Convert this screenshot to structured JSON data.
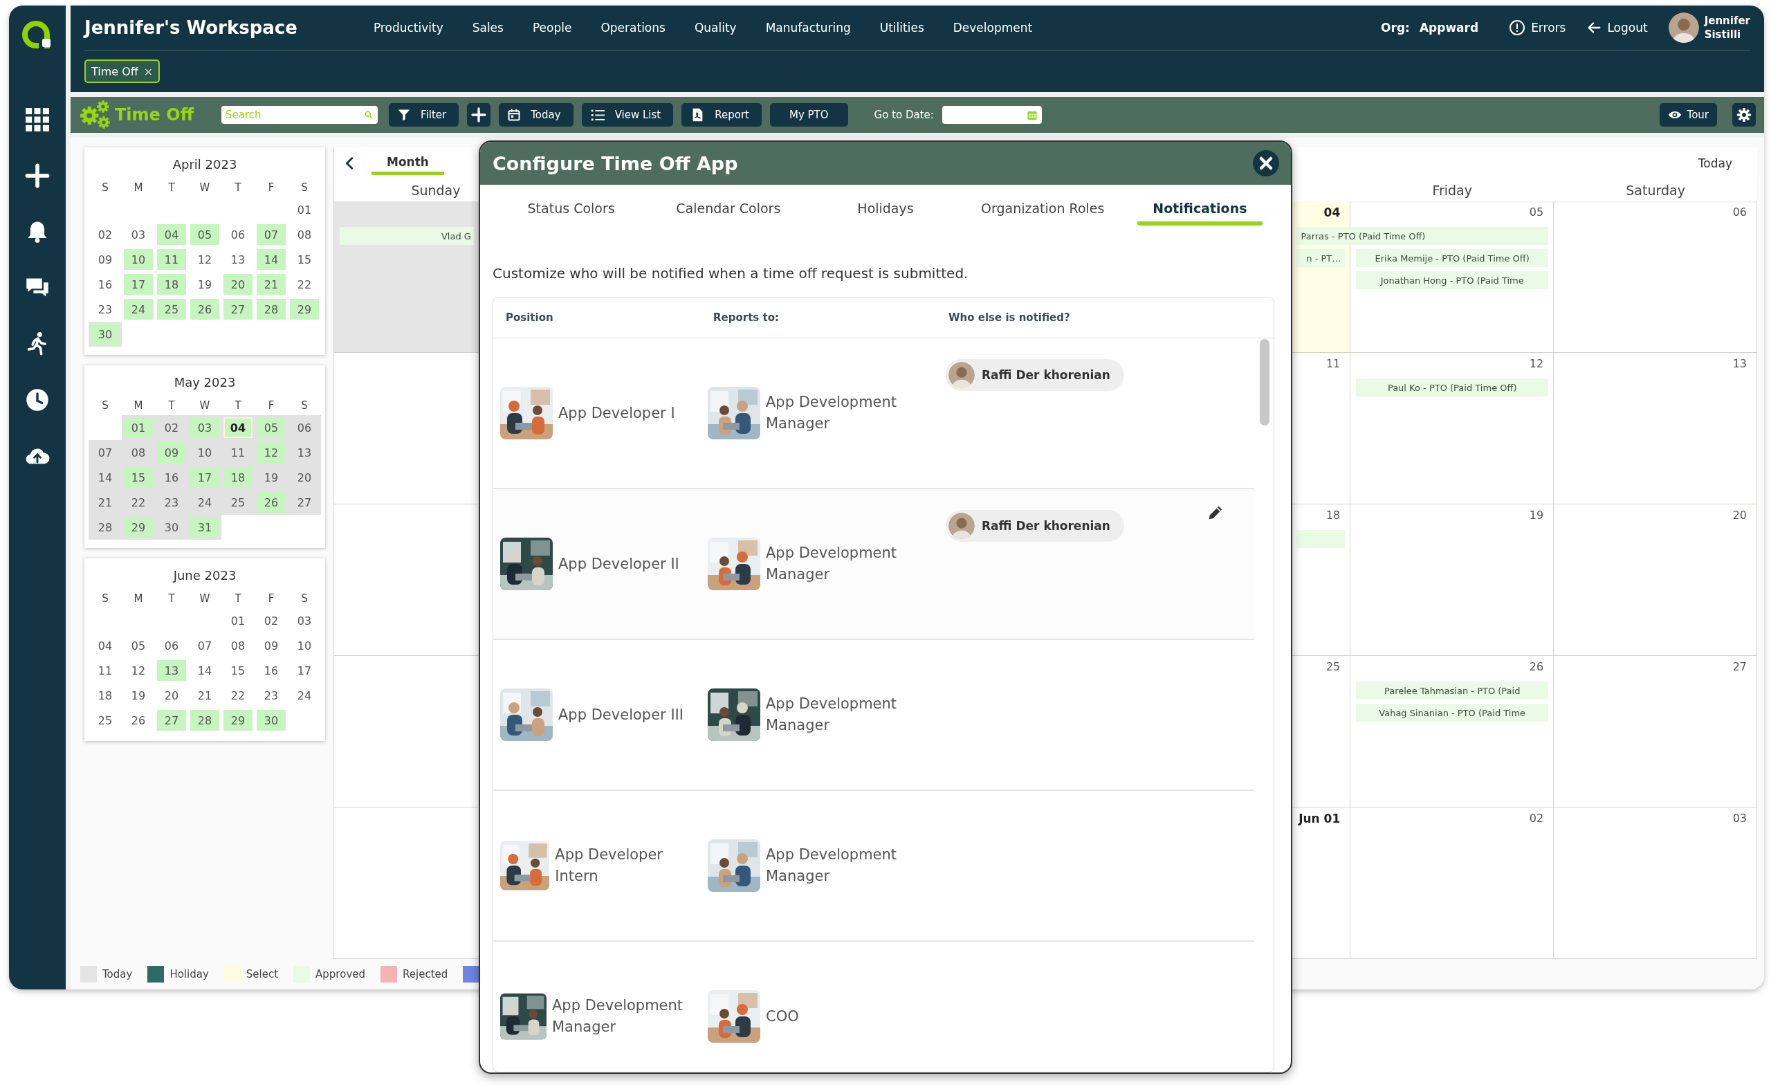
{
  "header": {
    "title": "Jennifer's Workspace",
    "nav": [
      "Productivity",
      "Sales",
      "People",
      "Operations",
      "Quality",
      "Manufacturing",
      "Utilities",
      "Development"
    ],
    "org_label": "Org:",
    "org": "Appward",
    "errors": "Errors",
    "logout": "Logout",
    "user": [
      "Jennifer",
      "Sistilli"
    ],
    "open_tabs": [
      {
        "label": "Time Off",
        "close": "×"
      }
    ]
  },
  "toolbar": {
    "app_title": "Time Off",
    "search": {
      "placeholder": "Search"
    },
    "buttons": [
      {
        "kind": "filter",
        "label": "Filter"
      },
      {
        "kind": "add"
      },
      {
        "kind": "today",
        "label": "Today"
      },
      {
        "kind": "list",
        "label": "View List"
      },
      {
        "kind": "report",
        "label": "Report"
      },
      {
        "kind": "plain",
        "label": "My PTO"
      }
    ],
    "go_to_date_label": "Go to Date:",
    "tour": "Tour"
  },
  "mini_calendars": [
    {
      "title": "April 2023",
      "weekdays": [
        "S",
        "M",
        "T",
        "W",
        "T",
        "F",
        "S"
      ],
      "weeks": [
        [
          {
            "kind": "blank"
          },
          {
            "kind": "blank"
          },
          {
            "kind": "blank"
          },
          {
            "kind": "blank"
          },
          {
            "kind": "blank"
          },
          {
            "kind": "blank"
          },
          {
            "kind": "day",
            "day": "01",
            "marked": false,
            "in_view": false,
            "today": false
          }
        ],
        [
          {
            "kind": "day",
            "day": "02",
            "marked": false,
            "in_view": false,
            "today": false
          },
          {
            "kind": "day",
            "day": "03",
            "marked": false,
            "in_view": false,
            "today": false
          },
          {
            "kind": "day",
            "day": "04",
            "marked": true,
            "in_view": false,
            "today": false
          },
          {
            "kind": "day",
            "day": "05",
            "marked": true,
            "in_view": false,
            "today": false
          },
          {
            "kind": "day",
            "day": "06",
            "marked": false,
            "in_view": false,
            "today": false
          },
          {
            "kind": "day",
            "day": "07",
            "marked": true,
            "in_view": false,
            "today": false
          },
          {
            "kind": "day",
            "day": "08",
            "marked": false,
            "in_view": false,
            "today": false
          }
        ],
        [
          {
            "kind": "day",
            "day": "09",
            "marked": false,
            "in_view": false,
            "today": false
          },
          {
            "kind": "day",
            "day": "10",
            "marked": true,
            "in_view": false,
            "today": false
          },
          {
            "kind": "day",
            "day": "11",
            "marked": true,
            "in_view": false,
            "today": false
          },
          {
            "kind": "day",
            "day": "12",
            "marked": false,
            "in_view": false,
            "today": false
          },
          {
            "kind": "day",
            "day": "13",
            "marked": false,
            "in_view": false,
            "today": false
          },
          {
            "kind": "day",
            "day": "14",
            "marked": true,
            "in_view": false,
            "today": false
          },
          {
            "kind": "day",
            "day": "15",
            "marked": false,
            "in_view": false,
            "today": false
          }
        ],
        [
          {
            "kind": "day",
            "day": "16",
            "marked": false,
            "in_view": false,
            "today": false
          },
          {
            "kind": "day",
            "day": "17",
            "marked": true,
            "in_view": false,
            "today": false
          },
          {
            "kind": "day",
            "day": "18",
            "marked": true,
            "in_view": false,
            "today": false
          },
          {
            "kind": "day",
            "day": "19",
            "marked": false,
            "in_view": false,
            "today": false
          },
          {
            "kind": "day",
            "day": "20",
            "marked": true,
            "in_view": false,
            "today": false
          },
          {
            "kind": "day",
            "day": "21",
            "marked": true,
            "in_view": false,
            "today": false
          },
          {
            "kind": "day",
            "day": "22",
            "marked": false,
            "in_view": false,
            "today": false
          }
        ],
        [
          {
            "kind": "day",
            "day": "23",
            "marked": false,
            "in_view": false,
            "today": false
          },
          {
            "kind": "day",
            "day": "24",
            "marked": true,
            "in_view": false,
            "today": false
          },
          {
            "kind": "day",
            "day": "25",
            "marked": true,
            "in_view": false,
            "today": false
          },
          {
            "kind": "day",
            "day": "26",
            "marked": true,
            "in_view": false,
            "today": false
          },
          {
            "kind": "day",
            "day": "27",
            "marked": true,
            "in_view": false,
            "today": false
          },
          {
            "kind": "day",
            "day": "28",
            "marked": true,
            "in_view": false,
            "today": false
          },
          {
            "kind": "day",
            "day": "29",
            "marked": true,
            "in_view": false,
            "today": false
          }
        ],
        [
          {
            "kind": "day",
            "day": "30",
            "marked": true,
            "in_view": true,
            "today": false
          }
        ]
      ]
    },
    {
      "title": "May 2023",
      "weekdays": [
        "S",
        "M",
        "T",
        "W",
        "T",
        "F",
        "S"
      ],
      "weeks": [
        [
          {
            "kind": "blank"
          },
          {
            "kind": "day",
            "day": "01",
            "marked": true,
            "in_view": true,
            "today": false
          },
          {
            "kind": "day",
            "day": "02",
            "marked": false,
            "in_view": true,
            "today": false
          },
          {
            "kind": "day",
            "day": "03",
            "marked": true,
            "in_view": true,
            "today": false
          },
          {
            "kind": "day",
            "day": "04",
            "marked": true,
            "in_view": true,
            "today": true
          },
          {
            "kind": "day",
            "day": "05",
            "marked": true,
            "in_view": true,
            "today": false
          },
          {
            "kind": "day",
            "day": "06",
            "marked": false,
            "in_view": true,
            "today": false
          }
        ],
        [
          {
            "kind": "day",
            "day": "07",
            "marked": false,
            "in_view": true,
            "today": false
          },
          {
            "kind": "day",
            "day": "08",
            "marked": false,
            "in_view": true,
            "today": false
          },
          {
            "kind": "day",
            "day": "09",
            "marked": true,
            "in_view": true,
            "today": false
          },
          {
            "kind": "day",
            "day": "10",
            "marked": false,
            "in_view": true,
            "today": false
          },
          {
            "kind": "day",
            "day": "11",
            "marked": false,
            "in_view": true,
            "today": false
          },
          {
            "kind": "day",
            "day": "12",
            "marked": true,
            "in_view": true,
            "today": false
          },
          {
            "kind": "day",
            "day": "13",
            "marked": false,
            "in_view": true,
            "today": false
          }
        ],
        [
          {
            "kind": "day",
            "day": "14",
            "marked": false,
            "in_view": true,
            "today": false
          },
          {
            "kind": "day",
            "day": "15",
            "marked": true,
            "in_view": true,
            "today": false
          },
          {
            "kind": "day",
            "day": "16",
            "marked": false,
            "in_view": true,
            "today": false
          },
          {
            "kind": "day",
            "day": "17",
            "marked": true,
            "in_view": true,
            "today": false
          },
          {
            "kind": "day",
            "day": "18",
            "marked": true,
            "in_view": true,
            "today": false
          },
          {
            "kind": "day",
            "day": "19",
            "marked": false,
            "in_view": true,
            "today": false
          },
          {
            "kind": "day",
            "day": "20",
            "marked": false,
            "in_view": true,
            "today": false
          }
        ],
        [
          {
            "kind": "day",
            "day": "21",
            "marked": false,
            "in_view": true,
            "today": false
          },
          {
            "kind": "day",
            "day": "22",
            "marked": false,
            "in_view": true,
            "today": false
          },
          {
            "kind": "day",
            "day": "23",
            "marked": false,
            "in_view": true,
            "today": false
          },
          {
            "kind": "day",
            "day": "24",
            "marked": false,
            "in_view": true,
            "today": false
          },
          {
            "kind": "day",
            "day": "25",
            "marked": false,
            "in_view": true,
            "today": false
          },
          {
            "kind": "day",
            "day": "26",
            "marked": true,
            "in_view": true,
            "today": false
          },
          {
            "kind": "day",
            "day": "27",
            "marked": false,
            "in_view": true,
            "today": false
          }
        ],
        [
          {
            "kind": "day",
            "day": "28",
            "marked": false,
            "in_view": true,
            "today": false
          },
          {
            "kind": "day",
            "day": "29",
            "marked": true,
            "in_view": true,
            "today": false
          },
          {
            "kind": "day",
            "day": "30",
            "marked": false,
            "in_view": true,
            "today": false
          },
          {
            "kind": "day",
            "day": "31",
            "marked": true,
            "in_view": true,
            "today": false
          }
        ]
      ]
    },
    {
      "title": "June 2023",
      "weekdays": [
        "S",
        "M",
        "T",
        "W",
        "T",
        "F",
        "S"
      ],
      "weeks": [
        [
          {
            "kind": "blank"
          },
          {
            "kind": "blank"
          },
          {
            "kind": "blank"
          },
          {
            "kind": "blank"
          },
          {
            "kind": "day",
            "day": "01",
            "marked": false,
            "in_view": false,
            "today": false
          },
          {
            "kind": "day",
            "day": "02",
            "marked": false,
            "in_view": false,
            "today": false
          },
          {
            "kind": "day",
            "day": "03",
            "marked": false,
            "in_view": false,
            "today": false
          }
        ],
        [
          {
            "kind": "day",
            "day": "04",
            "marked": false,
            "in_view": false,
            "today": false
          },
          {
            "kind": "day",
            "day": "05",
            "marked": false,
            "in_view": false,
            "today": false
          },
          {
            "kind": "day",
            "day": "06",
            "marked": false,
            "in_view": false,
            "today": false
          },
          {
            "kind": "day",
            "day": "07",
            "marked": false,
            "in_view": false,
            "today": false
          },
          {
            "kind": "day",
            "day": "08",
            "marked": false,
            "in_view": false,
            "today": false
          },
          {
            "kind": "day",
            "day": "09",
            "marked": false,
            "in_view": false,
            "today": false
          },
          {
            "kind": "day",
            "day": "10",
            "marked": false,
            "in_view": false,
            "today": false
          }
        ],
        [
          {
            "kind": "day",
            "day": "11",
            "marked": false,
            "in_view": false,
            "today": false
          },
          {
            "kind": "day",
            "day": "12",
            "marked": false,
            "in_view": false,
            "today": false
          },
          {
            "kind": "day",
            "day": "13",
            "marked": true,
            "in_view": false,
            "today": false
          },
          {
            "kind": "day",
            "day": "14",
            "marked": false,
            "in_view": false,
            "today": false
          },
          {
            "kind": "day",
            "day": "15",
            "marked": false,
            "in_view": false,
            "today": false
          },
          {
            "kind": "day",
            "day": "16",
            "marked": false,
            "in_view": false,
            "today": false
          },
          {
            "kind": "day",
            "day": "17",
            "marked": false,
            "in_view": false,
            "today": false
          }
        ],
        [
          {
            "kind": "day",
            "day": "18",
            "marked": false,
            "in_view": false,
            "today": false
          },
          {
            "kind": "day",
            "day": "19",
            "marked": false,
            "in_view": false,
            "today": false
          },
          {
            "kind": "day",
            "day": "20",
            "marked": false,
            "in_view": false,
            "today": false
          },
          {
            "kind": "day",
            "day": "21",
            "marked": false,
            "in_view": false,
            "today": false
          },
          {
            "kind": "day",
            "day": "22",
            "marked": false,
            "in_view": false,
            "today": false
          },
          {
            "kind": "day",
            "day": "23",
            "marked": false,
            "in_view": false,
            "today": false
          },
          {
            "kind": "day",
            "day": "24",
            "marked": false,
            "in_view": false,
            "today": false
          }
        ],
        [
          {
            "kind": "day",
            "day": "25",
            "marked": false,
            "in_view": false,
            "today": false
          },
          {
            "kind": "day",
            "day": "26",
            "marked": false,
            "in_view": false,
            "today": false
          },
          {
            "kind": "day",
            "day": "27",
            "marked": true,
            "in_view": false,
            "today": false
          },
          {
            "kind": "day",
            "day": "28",
            "marked": true,
            "in_view": false,
            "today": false
          },
          {
            "kind": "day",
            "day": "29",
            "marked": true,
            "in_view": false,
            "today": false
          },
          {
            "kind": "day",
            "day": "30",
            "marked": true,
            "in_view": false,
            "today": false
          }
        ]
      ]
    }
  ],
  "calendar": {
    "views": [
      {
        "label": "Month",
        "selected": true
      }
    ],
    "today_link": "Today",
    "weekdays": [
      {
        "kind": "header",
        "label": "Sunday"
      },
      {
        "kind": "covered"
      },
      {
        "kind": "covered"
      },
      {
        "kind": "covered"
      },
      {
        "kind": "covered"
      },
      {
        "kind": "header",
        "label": "Friday"
      },
      {
        "kind": "header",
        "label": "Saturday"
      }
    ],
    "weeks": [
      {
        "cells": [
          {
            "kind": "day",
            "shaded": true,
            "today": false,
            "events": [
              {
                "kind": "single",
                "text": "Vlad G"
              }
            ]
          },
          {
            "kind": "covered"
          },
          {
            "kind": "covered"
          },
          {
            "kind": "covered"
          },
          {
            "kind": "day",
            "date": "04",
            "shaded": false,
            "today": true,
            "bold": true,
            "events": [
              {
                "kind": "span",
                "text": "Parras - PTO (Paid Time Off)"
              },
              {
                "kind": "single",
                "text": "n - PT…"
              }
            ]
          },
          {
            "kind": "day",
            "date": "05",
            "shaded": false,
            "today": false,
            "bold": false,
            "events": [
              {
                "kind": "single",
                "text": "Erika Memije - PTO (Paid Time Off)"
              },
              {
                "kind": "single",
                "text": "Jonathan Hong - PTO (Paid Time"
              }
            ]
          },
          {
            "kind": "day",
            "date": "06",
            "shaded": false,
            "today": false,
            "bold": false
          }
        ]
      },
      {
        "cells": [
          {
            "kind": "day",
            "shaded": false,
            "today": false
          },
          {
            "kind": "covered"
          },
          {
            "kind": "covered"
          },
          {
            "kind": "covered"
          },
          {
            "kind": "day",
            "date": "11",
            "shaded": false,
            "today": false,
            "bold": false
          },
          {
            "kind": "day",
            "date": "12",
            "shaded": false,
            "today": false,
            "bold": false,
            "events": [
              {
                "kind": "single",
                "text": "Paul Ko - PTO (Paid Time Off)"
              }
            ]
          },
          {
            "kind": "day",
            "date": "13",
            "shaded": false,
            "today": false,
            "bold": false
          }
        ]
      },
      {
        "cells": [
          {
            "kind": "day",
            "shaded": false,
            "today": false
          },
          {
            "kind": "covered"
          },
          {
            "kind": "covered"
          },
          {
            "kind": "covered"
          },
          {
            "kind": "day",
            "date": "18",
            "shaded": false,
            "today": false,
            "bold": false,
            "events": [
              {
                "kind": "single"
              }
            ]
          },
          {
            "kind": "day",
            "date": "19",
            "shaded": false,
            "today": false,
            "bold": false
          },
          {
            "kind": "day",
            "date": "20",
            "shaded": false,
            "today": false,
            "bold": false
          }
        ]
      },
      {
        "cells": [
          {
            "kind": "day",
            "shaded": false,
            "today": false
          },
          {
            "kind": "covered"
          },
          {
            "kind": "covered"
          },
          {
            "kind": "covered"
          },
          {
            "kind": "day",
            "date": "25",
            "shaded": false,
            "today": false,
            "bold": false
          },
          {
            "kind": "day",
            "date": "26",
            "shaded": false,
            "today": false,
            "bold": false,
            "events": [
              {
                "kind": "single",
                "text": "Parelee Tahmasian - PTO (Paid"
              },
              {
                "kind": "single",
                "text": "Vahag Sinanian - PTO (Paid Time"
              }
            ]
          },
          {
            "kind": "day",
            "date": "27",
            "shaded": false,
            "today": false,
            "bold": false
          }
        ]
      },
      {
        "cells": [
          {
            "kind": "day",
            "shaded": false,
            "today": false
          },
          {
            "kind": "covered"
          },
          {
            "kind": "covered"
          },
          {
            "kind": "covered"
          },
          {
            "kind": "day",
            "date": "Jun 01",
            "shaded": false,
            "today": false,
            "bold": true
          },
          {
            "kind": "day",
            "date": "02",
            "shaded": false,
            "today": false,
            "bold": false
          },
          {
            "kind": "day",
            "date": "03",
            "shaded": false,
            "today": false,
            "bold": false
          }
        ]
      }
    ]
  },
  "legend": [
    {
      "label": "Today",
      "color": "#e4e4e4"
    },
    {
      "label": "Holiday",
      "color": "#2f6b62"
    },
    {
      "label": "Select",
      "color": "#fffbe0"
    },
    {
      "label": "Approved",
      "color": "#e8fbe3"
    },
    {
      "label": "Rejected",
      "color": "#f7b3b3"
    },
    {
      "color": "#6d86e6"
    }
  ],
  "modal": {
    "title": "Configure Time Off App",
    "tabs": [
      {
        "label": "Status Colors",
        "selected": false
      },
      {
        "label": "Calendar Colors",
        "selected": false
      },
      {
        "label": "Holidays",
        "selected": false
      },
      {
        "label": "Organization Roles",
        "selected": false
      },
      {
        "label": "Notifications",
        "selected": true
      }
    ],
    "description": "Customize who will be notified when a time off request is submitted.",
    "columns": [
      "Position",
      "Reports to:",
      "Who else is notified?"
    ],
    "rows": [
      {
        "position": "App Developer I",
        "reports_to": "App Development Manager",
        "notified": [
          {
            "name": "Raffi Der khorenian"
          }
        ],
        "hovered": false
      },
      {
        "position": "App Developer II",
        "reports_to": "App Development Manager",
        "notified": [
          {
            "name": "Raffi Der khorenian"
          }
        ],
        "hovered": true
      },
      {
        "position": "App Developer III",
        "reports_to": "App Development Manager",
        "notified": [],
        "hovered": false
      },
      {
        "position": "App Developer Intern",
        "reports_to": "App Development Manager",
        "notified": [],
        "hovered": false
      },
      {
        "position": "App Development Manager",
        "reports_to": "COO",
        "notified": [],
        "hovered": false
      }
    ]
  }
}
